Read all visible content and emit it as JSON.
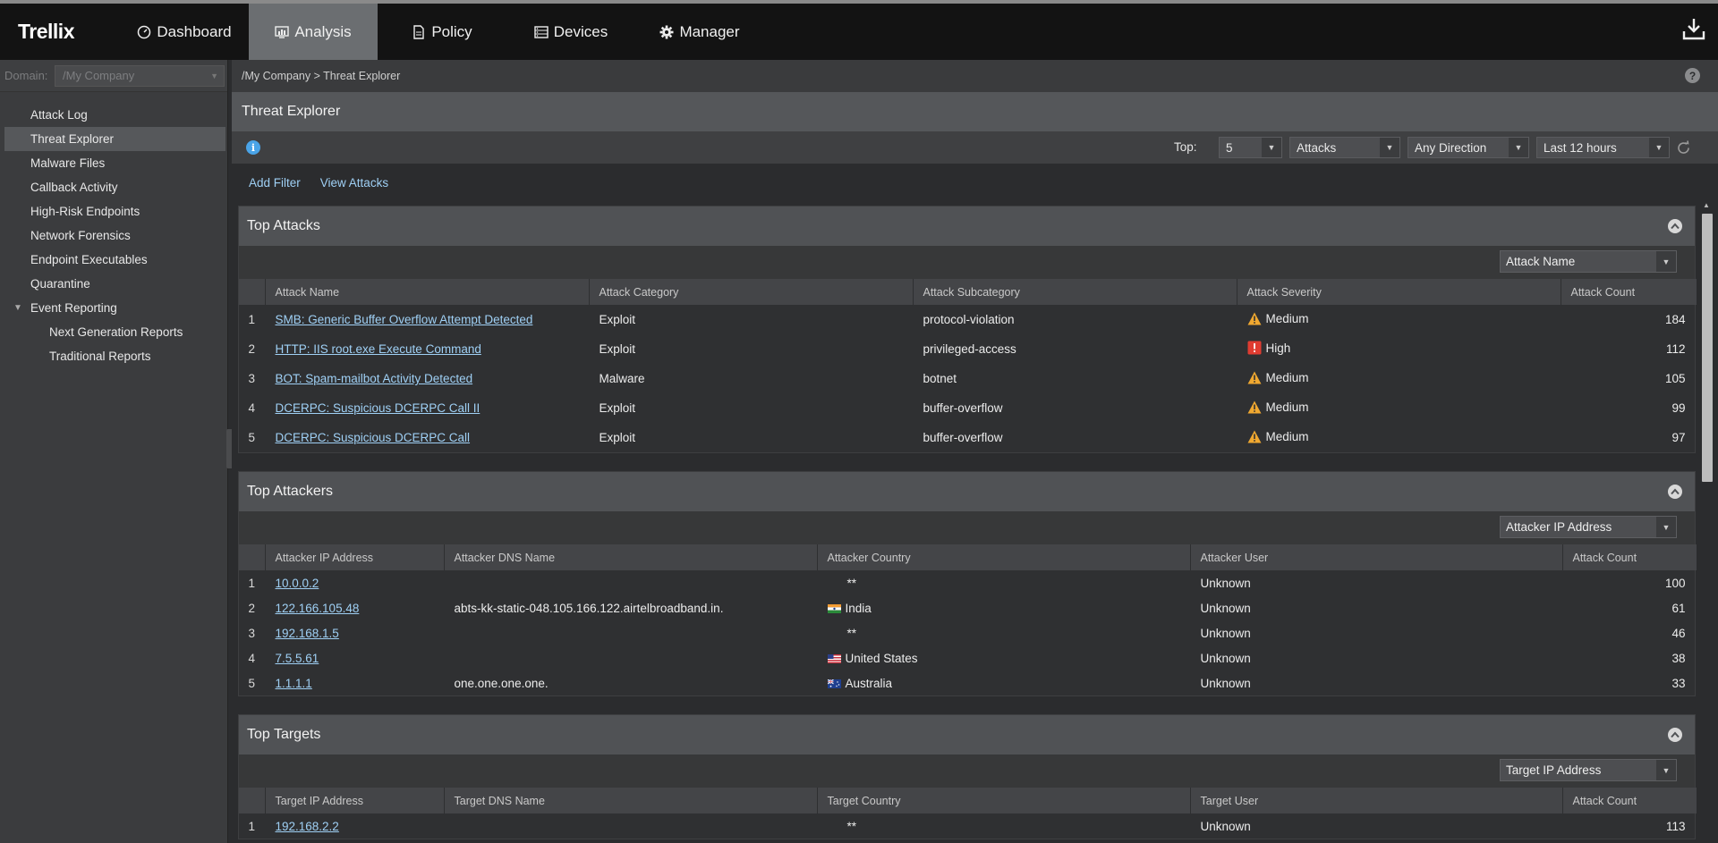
{
  "app": {
    "logo_text": "Trellix",
    "nav": [
      {
        "label": "Dashboard",
        "icon": "gauge-icon"
      },
      {
        "label": "Analysis",
        "icon": "chart-icon"
      },
      {
        "label": "Policy",
        "icon": "document-icon"
      },
      {
        "label": "Devices",
        "icon": "devices-icon"
      },
      {
        "label": "Manager",
        "icon": "gear-icon"
      }
    ],
    "active_nav": "Analysis"
  },
  "sidebar": {
    "domain_label": "Domain:",
    "domain_value": "/My Company",
    "items": [
      {
        "label": "Attack Log"
      },
      {
        "label": "Threat Explorer",
        "active": true
      },
      {
        "label": "Malware Files"
      },
      {
        "label": "Callback Activity"
      },
      {
        "label": "High-Risk Endpoints"
      },
      {
        "label": "Network Forensics"
      },
      {
        "label": "Endpoint Executables"
      },
      {
        "label": "Quarantine"
      },
      {
        "label": "Event Reporting",
        "expanded": true
      },
      {
        "label": "Next Generation Reports",
        "sub": true
      },
      {
        "label": "Traditional Reports",
        "sub": true
      }
    ]
  },
  "breadcrumb": "/My Company > Threat Explorer",
  "page_title": "Threat Explorer",
  "controls": {
    "top_label": "Top:",
    "top_value": "5",
    "metric_value": "Attacks",
    "direction_value": "Any Direction",
    "time_value": "Last 12 hours"
  },
  "filters": {
    "add_filter": "Add Filter",
    "view_attacks": "View Attacks"
  },
  "top_attacks": {
    "title": "Top Attacks",
    "group_by": "Attack Name",
    "columns": [
      "Attack Name",
      "Attack Category",
      "Attack Subcategory",
      "Attack Severity",
      "Attack Count"
    ],
    "rows": [
      {
        "idx": "1",
        "name": "SMB: Generic Buffer Overflow Attempt Detected",
        "category": "Exploit",
        "subcategory": "protocol-violation",
        "severity": "Medium",
        "count": "184"
      },
      {
        "idx": "2",
        "name": "HTTP: IIS root.exe Execute Command",
        "category": "Exploit",
        "subcategory": "privileged-access",
        "severity": "High",
        "count": "112"
      },
      {
        "idx": "3",
        "name": "BOT: Spam-mailbot Activity Detected",
        "category": "Malware",
        "subcategory": "botnet",
        "severity": "Medium",
        "count": "105"
      },
      {
        "idx": "4",
        "name": "DCERPC: Suspicious DCERPC Call II",
        "category": "Exploit",
        "subcategory": "buffer-overflow",
        "severity": "Medium",
        "count": "99"
      },
      {
        "idx": "5",
        "name": "DCERPC: Suspicious DCERPC Call",
        "category": "Exploit",
        "subcategory": "buffer-overflow",
        "severity": "Medium",
        "count": "97"
      }
    ]
  },
  "top_attackers": {
    "title": "Top Attackers",
    "group_by": "Attacker IP Address",
    "columns": [
      "Attacker IP Address",
      "Attacker DNS Name",
      "Attacker Country",
      "Attacker User",
      "Attack Count"
    ],
    "rows": [
      {
        "idx": "1",
        "ip": "10.0.0.2",
        "dns": "",
        "country": "**",
        "flag": "",
        "user": "Unknown",
        "count": "100"
      },
      {
        "idx": "2",
        "ip": "122.166.105.48",
        "dns": "abts-kk-static-048.105.166.122.airtelbroadband.in.",
        "country": "India",
        "flag": "india",
        "user": "Unknown",
        "count": "61"
      },
      {
        "idx": "3",
        "ip": "192.168.1.5",
        "dns": "",
        "country": "**",
        "flag": "",
        "user": "Unknown",
        "count": "46"
      },
      {
        "idx": "4",
        "ip": "7.5.5.61",
        "dns": "",
        "country": "United States",
        "flag": "us",
        "user": "Unknown",
        "count": "38"
      },
      {
        "idx": "5",
        "ip": "1.1.1.1",
        "dns": "one.one.one.one.",
        "country": "Australia",
        "flag": "au",
        "user": "Unknown",
        "count": "33"
      }
    ]
  },
  "top_targets": {
    "title": "Top Targets",
    "group_by": "Target IP Address",
    "columns": [
      "Target IP Address",
      "Target DNS Name",
      "Target Country",
      "Target User",
      "Attack Count"
    ],
    "rows": [
      {
        "idx": "1",
        "ip": "192.168.2.2",
        "dns": "",
        "country": "**",
        "flag": "",
        "user": "Unknown",
        "count": "113"
      }
    ]
  },
  "colors": {
    "accent_link": "#9fd0f5",
    "medium": "#f0a830",
    "high": "#e03c31"
  }
}
